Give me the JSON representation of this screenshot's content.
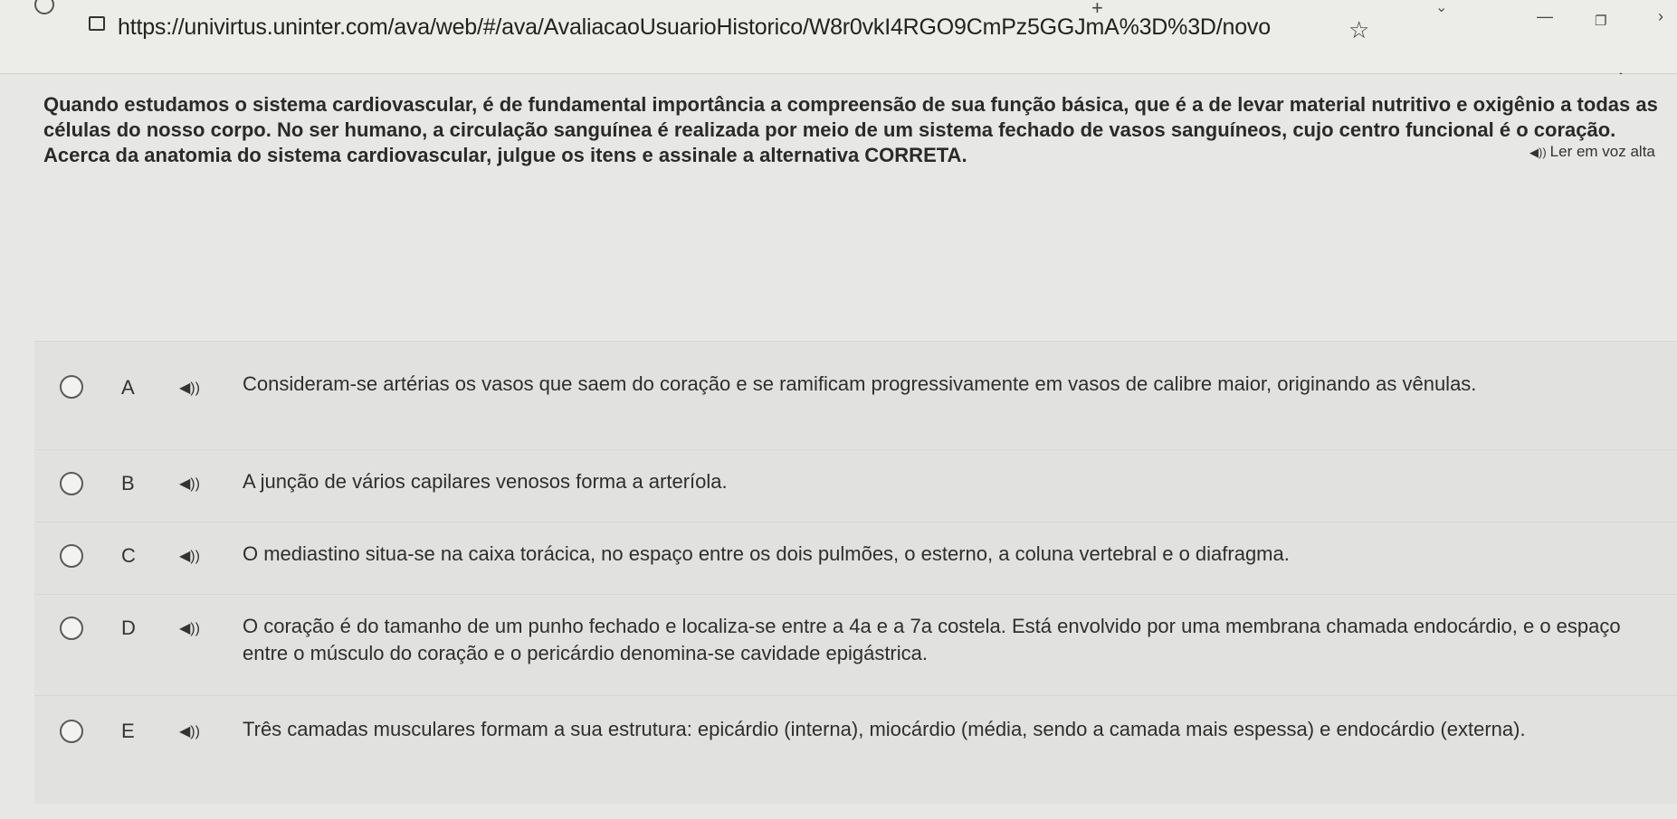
{
  "browser": {
    "url": "https://univirtus.uninter.com/ava/web/#/ava/AvaliacaoUsuarioHistorico/W8r0vkI4RGO9CmPz5GGJmA%3D%3D/novo"
  },
  "read_aloud": {
    "label": "Ler em voz alta"
  },
  "question": {
    "text": "Quando estudamos o sistema cardiovascular, é de fundamental importância a compreensão de sua função básica, que é a de levar material nutritivo e oxigênio a todas as células do nosso corpo. No ser humano, a circulação sanguínea é realizada por meio de um sistema fechado de vasos sanguíneos, cujo centro funcional é o coração. Acerca da anatomia do sistema cardiovascular, julgue os itens e assinale a alternativa CORRETA."
  },
  "options": [
    {
      "letter": "A",
      "text": "Consideram-se artérias os vasos que saem do coração e se ramificam progressivamente em vasos de calibre maior, originando as vênulas."
    },
    {
      "letter": "B",
      "text": "A junção de vários capilares venosos forma a arteríola."
    },
    {
      "letter": "C",
      "text": "O mediastino situa-se na caixa torácica, no espaço entre os dois pulmões, o esterno, a coluna vertebral e o diafragma."
    },
    {
      "letter": "D",
      "text": "O coração é do tamanho de um punho fechado e localiza-se entre a 4a e a 7a costela. Está envolvido por uma membrana chamada endocárdio, e o espaço entre o músculo do coração e o pericárdio denomina-se cavidade epigástrica."
    },
    {
      "letter": "E",
      "text": "Três camadas musculares formam a sua estrutura: epicárdio (interna), miocárdio (média, sendo a camada mais espessa) e endocárdio (externa)."
    }
  ],
  "icons": {
    "speaker": "speaker-icon",
    "radio": "radio-button",
    "lock": "lock-icon",
    "star": "star-icon",
    "download": "download-icon",
    "share": "share-icon",
    "menu": "menu-icon"
  }
}
